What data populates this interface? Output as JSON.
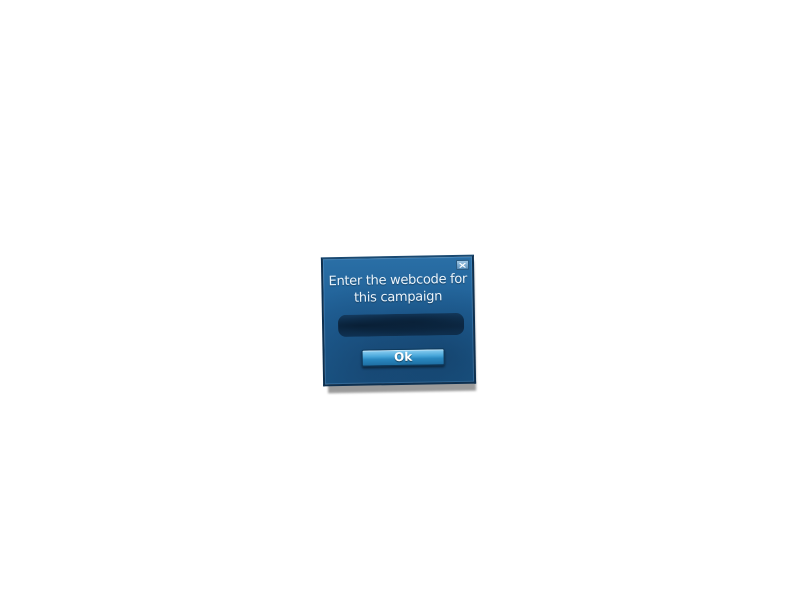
{
  "dialog": {
    "prompt": "Enter the webcode for this campaign",
    "code_value": "",
    "ok_label": "Ok",
    "close_icon": "close-icon"
  },
  "colors": {
    "panel": "#1f5f95",
    "panel_border": "#0d2f4f",
    "field": "#0f3152",
    "button": "#2a88c0",
    "text": "#eaf4fc",
    "background": "#ffffff"
  }
}
